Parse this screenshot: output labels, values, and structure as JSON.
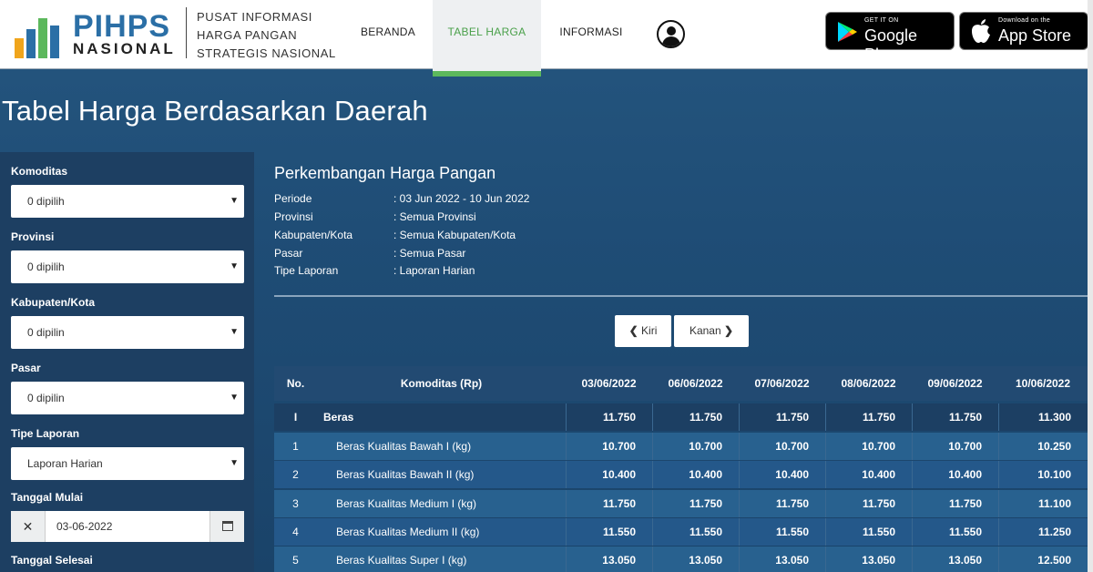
{
  "header": {
    "logo_title": "PIHPS",
    "logo_subtitle": "NASIONAL",
    "tagline": [
      "PUSAT INFORMASI",
      "HARGA PANGAN",
      "STRATEGIS NASIONAL"
    ],
    "nav": [
      "BERANDA",
      "TABEL HARGA",
      "INFORMASI"
    ],
    "active_nav": "TABEL HARGA",
    "google_play_small": "GET IT ON",
    "google_play_big": "Google Play",
    "app_store_small": "Download on the",
    "app_store_big": "App Store"
  },
  "colors": {
    "accent_green": "#5cb85c",
    "logo_blue": "#2b6fa6",
    "background": "#1f4d76"
  },
  "page_title": "Tabel Harga Berdasarkan Daerah",
  "sidebar": {
    "fields": [
      {
        "label": "Komoditas",
        "value": "0 dipilih"
      },
      {
        "label": "Provinsi",
        "value": "0 dipilih"
      },
      {
        "label": "Kabupaten/Kota",
        "value": "0 dipilin"
      },
      {
        "label": "Pasar",
        "value": "0 dipilin"
      },
      {
        "label": "Tipe Laporan",
        "value": "Laporan Harian"
      }
    ],
    "start_date_label": "Tanggal Mulai",
    "start_date_value": "03-06-2022",
    "end_date_label": "Tanggal Selesai"
  },
  "main": {
    "title": "Perkembangan Harga Pangan",
    "info": [
      {
        "key": "Periode",
        "value": ": 03 Jun 2022 - 10 Jun 2022"
      },
      {
        "key": "Provinsi",
        "value": ": Semua Provinsi"
      },
      {
        "key": "Kabupaten/Kota",
        "value": ": Semua Kabupaten/Kota"
      },
      {
        "key": "Pasar",
        "value": ": Semua Pasar"
      },
      {
        "key": "Tipe Laporan",
        "value": ": Laporan Harian"
      }
    ],
    "prev_label": "Kiri",
    "next_label": "Kanan"
  },
  "table": {
    "headers": [
      "No.",
      "Komoditas (Rp)",
      "03/06/2022",
      "06/06/2022",
      "07/06/2022",
      "08/06/2022",
      "09/06/2022",
      "10/06/2022"
    ],
    "rows": [
      {
        "no": "I",
        "name": "Beras",
        "values": [
          "11.750",
          "11.750",
          "11.750",
          "11.750",
          "11.750",
          "11.300"
        ],
        "group": true
      },
      {
        "no": "1",
        "name": "Beras Kualitas Bawah I (kg)",
        "values": [
          "10.700",
          "10.700",
          "10.700",
          "10.700",
          "10.700",
          "10.250"
        ],
        "group": false
      },
      {
        "no": "2",
        "name": "Beras Kualitas Bawah II (kg)",
        "values": [
          "10.400",
          "10.400",
          "10.400",
          "10.400",
          "10.400",
          "10.100"
        ],
        "group": false
      },
      {
        "no": "3",
        "name": "Beras Kualitas Medium I (kg)",
        "values": [
          "11.750",
          "11.750",
          "11.750",
          "11.750",
          "11.750",
          "11.100"
        ],
        "group": false
      },
      {
        "no": "4",
        "name": "Beras Kualitas Medium II (kg)",
        "values": [
          "11.550",
          "11.550",
          "11.550",
          "11.550",
          "11.550",
          "11.250"
        ],
        "group": false
      },
      {
        "no": "5",
        "name": "Beras Kualitas Super I (kg)",
        "values": [
          "13.050",
          "13.050",
          "13.050",
          "13.050",
          "13.050",
          "12.500"
        ],
        "group": false
      }
    ]
  }
}
